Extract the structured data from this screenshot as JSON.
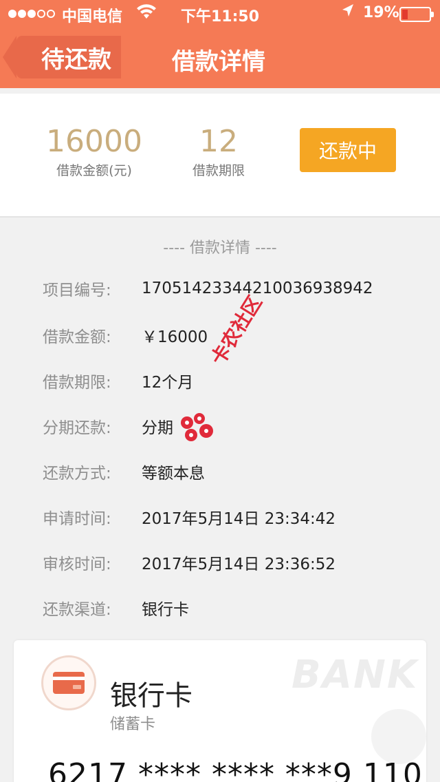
{
  "status_bar": {
    "carrier": "中国电信",
    "time": "下午11:50",
    "battery_percent": "19%"
  },
  "nav": {
    "back_label": "待还款",
    "title": "借款详情"
  },
  "summary": {
    "amount_value": "16000",
    "amount_caption": "借款金额(元)",
    "term_value": "12",
    "term_caption": "借款期限",
    "status_label": "还款中"
  },
  "details": {
    "section_title": "---- 借款详情 ----",
    "rows": [
      {
        "key": "项目编号:",
        "value": "17051423344210036938942"
      },
      {
        "key": "借款金额:",
        "value": "￥16000"
      },
      {
        "key": "借款期限:",
        "value": "12个月"
      },
      {
        "key": "分期还款:",
        "value": "分期"
      },
      {
        "key": "还款方式:",
        "value": "等额本息"
      },
      {
        "key": "申请时间:",
        "value": "2017年5月14日 23:34:42"
      },
      {
        "key": "审核时间:",
        "value": "2017年5月14日 23:36:52"
      },
      {
        "key": "还款渠道:",
        "value": "银行卡"
      }
    ]
  },
  "watermark": {
    "text": "卡农社区"
  },
  "bank_card": {
    "name": "银行卡",
    "type": "储蓄卡",
    "number": "6217 **** **** ***9 110",
    "background_text": "BANK"
  },
  "colors": {
    "header": "#f57a55",
    "accent_gold": "#c9ad7d",
    "status_button": "#f5a623"
  }
}
